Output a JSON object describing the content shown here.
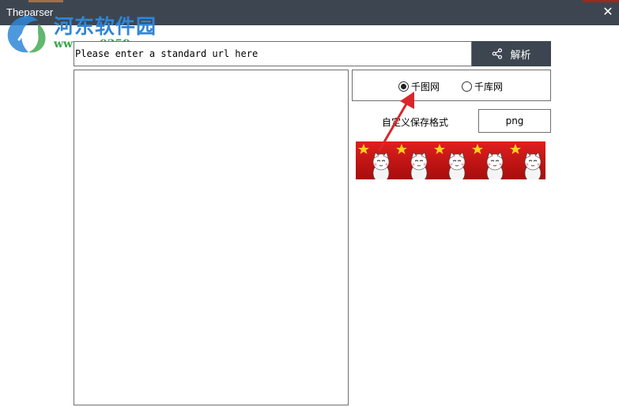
{
  "window": {
    "title": "Theparser",
    "close_glyph": "✕",
    "close_icon": "close-icon"
  },
  "watermark": {
    "name": "河东软件园",
    "url": "www.pc0359.cn"
  },
  "url_bar": {
    "placeholder": "Please enter a standard url here",
    "value": ""
  },
  "parse_button": {
    "label": "解析",
    "icon": "share-icon"
  },
  "sites": [
    {
      "label": "千图网",
      "selected": true
    },
    {
      "label": "千库网",
      "selected": false
    }
  ],
  "format": {
    "label": "自定义保存格式",
    "value": "png"
  },
  "colors": {
    "titlebar": "#3d4650",
    "button": "#3d4650",
    "border": "#707070",
    "annotation_arrow": "#d9262b",
    "watermark_blue": "#2f86d6",
    "watermark_green": "#3aa54a"
  }
}
